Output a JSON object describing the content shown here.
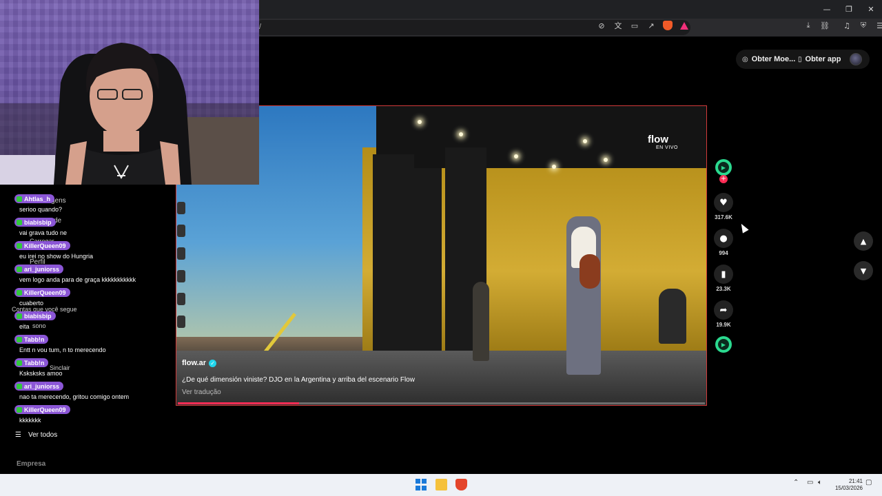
{
  "browser": {
    "url_fragment": "/",
    "window_controls": {
      "minimize": "—",
      "restore": "❐",
      "close": "✕"
    }
  },
  "page": {
    "get_coins_label": "Obter Moe...",
    "get_app_label": "Obter app"
  },
  "video": {
    "overlay_logo": "flow",
    "overlay_sub": "EN VIVO",
    "author": "flow.ar",
    "caption": "¿De qué dimensión viniste? DJO en la Argentina y arriba del escenario Flow",
    "translate_label": "Ver tradução",
    "progress": 0.23
  },
  "actions": {
    "likes": "317.6K",
    "comments": "994",
    "saves": "23.3K",
    "shares": "19.9K"
  },
  "chat": {
    "messages": [
      {
        "user": "Ahtlas_h",
        "text": "serioo quando?"
      },
      {
        "user": "biabisbip",
        "text": "vai grava tudo ne"
      },
      {
        "user": "KillerQueen09",
        "text": "eu irei no show do Hungria"
      },
      {
        "user": "ari_juniorss",
        "text": "vem logo anda para de graça kkkkkkkkkkk"
      },
      {
        "user": "KillerQueen09",
        "text": "cuaberto"
      },
      {
        "user": "biabisbip",
        "text": "eita"
      },
      {
        "user": "Tabb!n",
        "text": "Entt n vou tum, n to merecendo"
      },
      {
        "user": "Tabb!n",
        "text": "Ksksksks amoo"
      },
      {
        "user": "ari_juniorss",
        "text": "nao ta merecendo, gritou comigo ontem"
      },
      {
        "user": "KillerQueen09",
        "text": "kkkkkkk"
      }
    ],
    "ghost_labels": {
      "mensagens": "gens",
      "amizade": "de",
      "carregar": "Carregar",
      "perfil": "Perfil",
      "contas": "Contas que você segue",
      "sono": "sono",
      "sinclair": "Sinclair"
    }
  },
  "sidebar": {
    "see_all": "Ver todos",
    "company": "Empresa"
  },
  "taskbar": {
    "time": "21:41",
    "date": "15/03/2026"
  }
}
